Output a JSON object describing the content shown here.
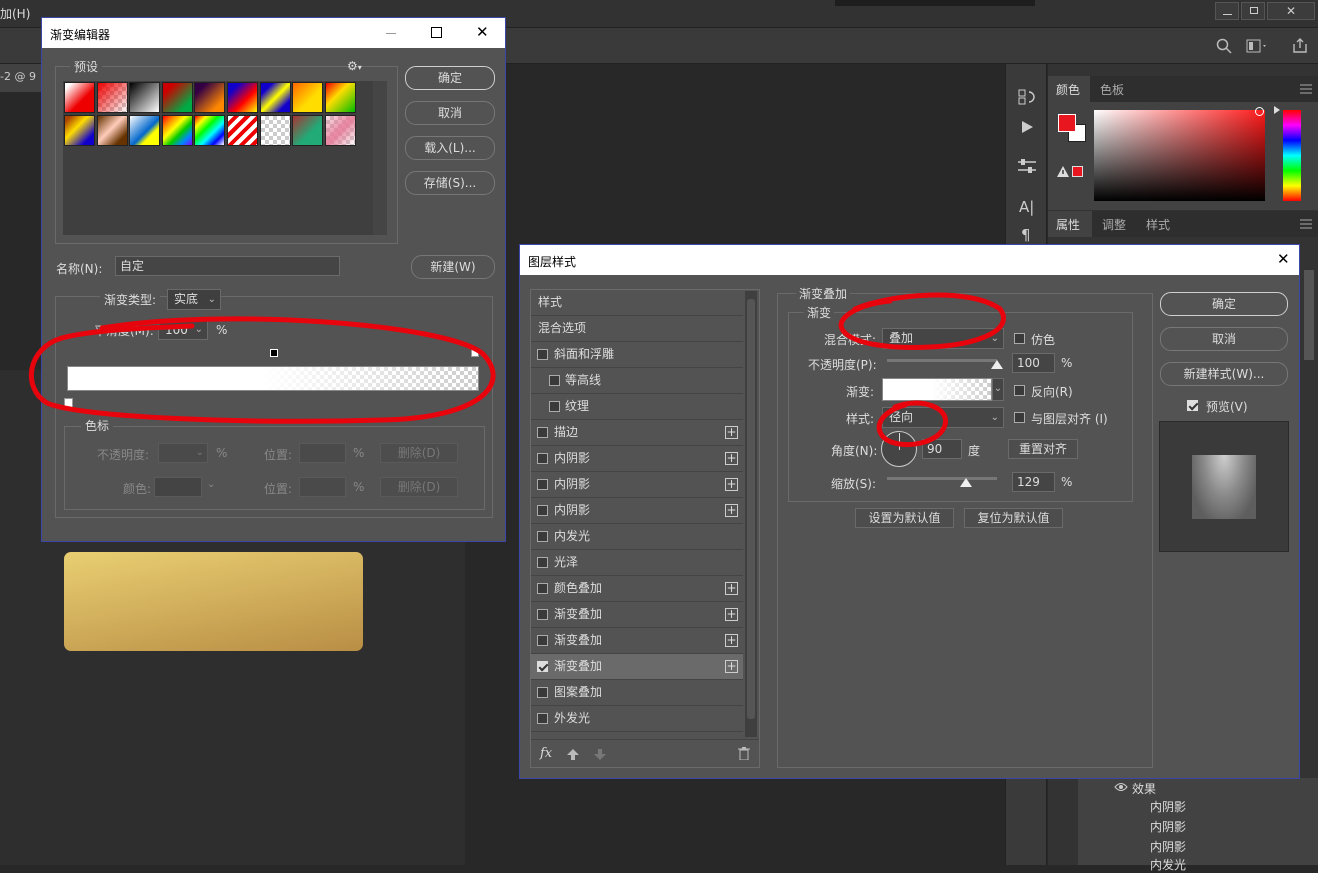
{
  "app": {
    "menu_fragment": "加(H)",
    "doc_tab_fragment": "-2 @ 9"
  },
  "gradient_editor": {
    "title": "渐变编辑器",
    "presets_label": "预设",
    "buttons": {
      "ok": "确定",
      "cancel": "取消",
      "load": "载入(L)...",
      "save": "存储(S)...",
      "new": "新建(W)"
    },
    "name_label": "名称(N):",
    "name_value": "自定",
    "gradient_type_label": "渐变类型:",
    "gradient_type_value": "实底",
    "smoothness_label": "平滑度(M):",
    "smoothness_value": "100",
    "percent": "%",
    "color_stops": {
      "title": "色标",
      "opacity_label": "不透明度:",
      "location_label": "位置:",
      "delete_label": "删除(D)",
      "color_label": "颜色:"
    }
  },
  "layer_style": {
    "title": "图层样式",
    "styles_header": "样式",
    "blending_options": "混合选项",
    "list": [
      {
        "label": "斜面和浮雕",
        "checked": false,
        "plus": false,
        "indent": false
      },
      {
        "label": "等高线",
        "checked": false,
        "plus": false,
        "indent": true
      },
      {
        "label": "纹理",
        "checked": false,
        "plus": false,
        "indent": true
      },
      {
        "label": "描边",
        "checked": false,
        "plus": true,
        "indent": false
      },
      {
        "label": "内阴影",
        "checked": false,
        "plus": true,
        "indent": false
      },
      {
        "label": "内阴影",
        "checked": false,
        "plus": true,
        "indent": false
      },
      {
        "label": "内阴影",
        "checked": false,
        "plus": true,
        "indent": false
      },
      {
        "label": "内发光",
        "checked": false,
        "plus": false,
        "indent": false
      },
      {
        "label": "光泽",
        "checked": false,
        "plus": false,
        "indent": false
      },
      {
        "label": "颜色叠加",
        "checked": false,
        "plus": true,
        "indent": false
      },
      {
        "label": "渐变叠加",
        "checked": false,
        "plus": true,
        "indent": false
      },
      {
        "label": "渐变叠加",
        "checked": false,
        "plus": true,
        "indent": false
      },
      {
        "label": "渐变叠加",
        "checked": true,
        "plus": true,
        "indent": false
      },
      {
        "label": "图案叠加",
        "checked": false,
        "plus": false,
        "indent": false
      },
      {
        "label": "外发光",
        "checked": false,
        "plus": false,
        "indent": false
      }
    ],
    "section_title": "渐变叠加",
    "group_title": "渐变",
    "blend_mode_label": "混合模式:",
    "blend_mode_value": "叠加",
    "dither_label": "仿色",
    "opacity_label": "不透明度(P):",
    "opacity_value": "100",
    "opacity_level": 1.0,
    "gradient_label": "渐变:",
    "reverse_label": "反向(R)",
    "style_label": "样式:",
    "style_value": "径向",
    "align_label": "与图层对齐 (I)",
    "angle_label": "角度(N):",
    "angle_value": "90",
    "degree_unit": "度",
    "reset_align": "重置对齐",
    "scale_label": "缩放(S):",
    "scale_value": "129",
    "scale_level": 0.72,
    "percent": "%",
    "make_default": "设置为默认值",
    "reset_default": "复位为默认值",
    "buttons": {
      "ok": "确定",
      "cancel": "取消",
      "new_style": "新建样式(W)...",
      "preview": "预览(V)"
    },
    "fx_label": "fx"
  },
  "right_panel": {
    "tabs_top": [
      "颜色",
      "色板"
    ],
    "tabs_bottom": [
      "属性",
      "调整",
      "样式"
    ],
    "fg_color": "#e8171f",
    "bg_color": "#ffffff",
    "layers": {
      "effects": "效果",
      "items": [
        "内阴影",
        "内阴影",
        "内阴影",
        "内发光"
      ]
    }
  },
  "canvas": {
    "gold_from": "#e9cf72",
    "gold_to": "#b98e45"
  }
}
